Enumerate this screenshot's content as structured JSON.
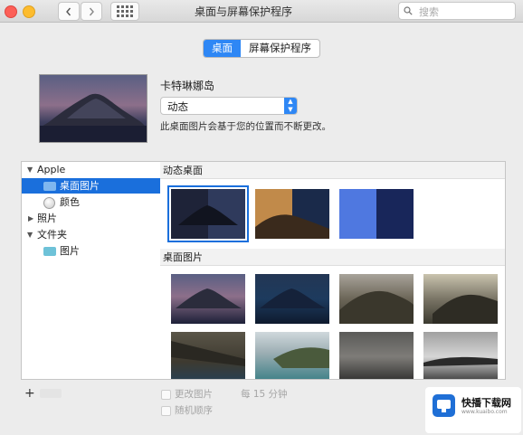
{
  "window": {
    "title": "桌面与屏幕保护程序"
  },
  "search": {
    "placeholder": "搜索"
  },
  "tabs": [
    {
      "label": "桌面",
      "selected": true
    },
    {
      "label": "屏幕保护程序",
      "selected": false
    }
  ],
  "current": {
    "name": "卡特琳娜岛",
    "mode": "动态",
    "description": "此桌面图片会基于您的位置而不断更改。"
  },
  "sidebar": {
    "items": [
      {
        "label": "Apple",
        "type": "group",
        "expanded": true
      },
      {
        "label": "桌面图片",
        "type": "folder",
        "selected": true
      },
      {
        "label": "颜色",
        "type": "colors"
      },
      {
        "label": "照片",
        "type": "group",
        "expanded": false
      },
      {
        "label": "文件夹",
        "type": "group",
        "expanded": true
      },
      {
        "label": "图片",
        "type": "folder"
      }
    ]
  },
  "sections": [
    {
      "title": "动态桌面",
      "tiles": [
        "catalina-dynamic",
        "mojave-dynamic",
        "gradient-blue"
      ]
    },
    {
      "title": "桌面图片",
      "tiles": [
        "catalina-1",
        "catalina-2",
        "catalina-3",
        "catalina-4",
        "catalina-5",
        "catalina-6",
        "catalina-7",
        "catalina-8"
      ]
    }
  ],
  "bottom": {
    "add_label": "+",
    "options": [
      "更改图片",
      "随机顺序",
      "每 15 分钟"
    ]
  },
  "watermark": {
    "name": "快播下载网",
    "url": "www.kuaibo.com"
  },
  "colors": {
    "accent": "#2e87f5",
    "selection": "#1a6fdc"
  }
}
